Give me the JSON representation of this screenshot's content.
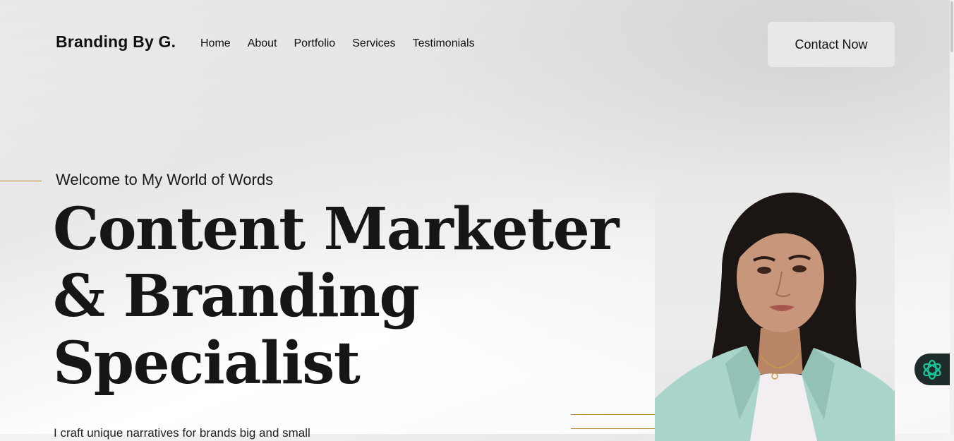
{
  "header": {
    "logo": "Branding By G.",
    "nav": [
      "Home",
      "About",
      "Portfolio",
      "Services",
      "Testimonials"
    ],
    "contact_button": "Contact Now"
  },
  "hero": {
    "kicker": "Welcome to My World of Words",
    "headline_lines": [
      "Content Marketer",
      "& Branding",
      "Specialist"
    ],
    "intro_partial": "I craft unique narratives for brands big and small"
  },
  "colors": {
    "accent_gold": "#b8862b",
    "text": "#161616",
    "button_bg": "#e7e8e8",
    "chat_widget_bg": "#1f2a2b",
    "chat_icon": "#19c59a"
  },
  "icons": {
    "chat_widget": "assistant-flower-icon"
  }
}
